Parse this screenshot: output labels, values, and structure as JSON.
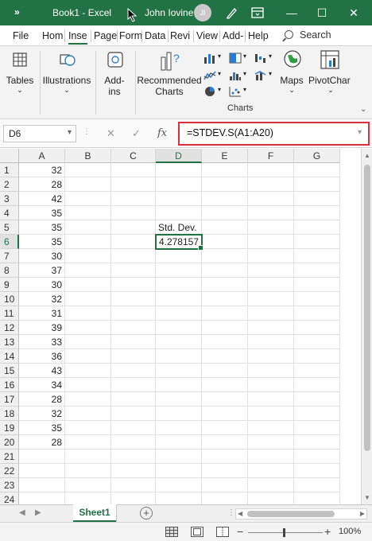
{
  "titlebar": {
    "quick_access": "»",
    "document_title": "Book1  -  Excel",
    "user_name": "John Iovine",
    "user_initials": "JI",
    "minimize": "—",
    "maximize": "☐",
    "close": "✕"
  },
  "tabs": [
    {
      "label": "File"
    },
    {
      "label": "Hom"
    },
    {
      "label": "Inse"
    },
    {
      "label": "Page"
    },
    {
      "label": "Form"
    },
    {
      "label": "Data"
    },
    {
      "label": "Revi"
    },
    {
      "label": "View"
    },
    {
      "label": "Add-"
    },
    {
      "label": "Help"
    }
  ],
  "active_tab_index": 2,
  "search_label": "Search",
  "ribbon": {
    "tables_label": "Tables",
    "illustrations_label": "Illustrations",
    "addins_line1": "Add-",
    "addins_line2": "ins",
    "recommended_line1": "Recommended",
    "recommended_line2": "Charts",
    "maps_label": "Maps",
    "pivotchart_label": "PivotChar",
    "group_label_charts": "Charts"
  },
  "formula_bar": {
    "name_box": "D6",
    "cancel_glyph": "✕",
    "enter_glyph": "✓",
    "fx_glyph": "fx",
    "formula": "=STDEV.S(A1:A20)"
  },
  "columns": [
    "A",
    "B",
    "C",
    "D",
    "E",
    "F",
    "G"
  ],
  "selected_column": "D",
  "rows": [
    "1",
    "2",
    "3",
    "4",
    "5",
    "6",
    "7",
    "8",
    "9",
    "10",
    "11",
    "12",
    "13",
    "14",
    "15",
    "16",
    "17",
    "18",
    "19",
    "20",
    "21",
    "22",
    "23",
    "24"
  ],
  "selected_row": "6",
  "column_a_values": [
    "32",
    "28",
    "42",
    "35",
    "35",
    "35",
    "30",
    "37",
    "30",
    "32",
    "31",
    "39",
    "33",
    "36",
    "43",
    "34",
    "28",
    "32",
    "35",
    "28"
  ],
  "cells": {
    "d5": "Std. Dev.",
    "d6": "4.278157"
  },
  "sheets": [
    {
      "name": "Sheet1"
    }
  ],
  "add_sheet": "+",
  "status": {
    "zoom": "100%",
    "zoom_minus": "−",
    "zoom_plus": "+"
  },
  "colors": {
    "brand_green": "#217346",
    "highlight_red": "#e0303b"
  }
}
